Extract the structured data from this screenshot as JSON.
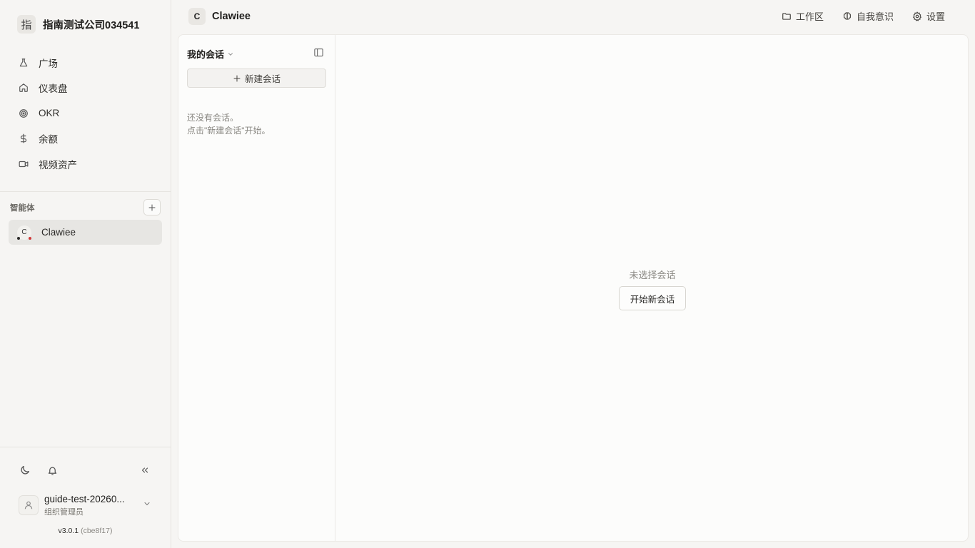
{
  "sidebar": {
    "org": {
      "avatar_char": "指",
      "name": "指南测试公司034541"
    },
    "nav": [
      {
        "icon": "flask-icon",
        "label": "广场"
      },
      {
        "icon": "home-icon",
        "label": "仪表盘"
      },
      {
        "icon": "target-icon",
        "label": "OKR"
      },
      {
        "icon": "dollar-icon",
        "label": "余额"
      },
      {
        "icon": "video-icon",
        "label": "视频资产"
      }
    ],
    "agents_label": "智能体",
    "agents": [
      {
        "avatar_char": "C",
        "name": "Clawiee",
        "status_colors": [
          "#2b2a28",
          "#d03a3a"
        ]
      }
    ],
    "user": {
      "name": "guide-test-20260...",
      "role": "组织管理员"
    },
    "version": {
      "number": "v3.0.1",
      "hash": "(cbe8f17)"
    }
  },
  "header": {
    "agent": {
      "avatar_char": "C",
      "name": "Clawiee"
    },
    "actions": [
      {
        "icon": "folder-icon",
        "label": "工作区"
      },
      {
        "icon": "brain-icon",
        "label": "自我意识"
      },
      {
        "icon": "gear-icon",
        "label": "设置"
      }
    ]
  },
  "conversations": {
    "title": "我的会话",
    "new_button": "新建会话",
    "empty_line1": "还没有会话。",
    "empty_line2": "点击\"新建会话\"开始。"
  },
  "content": {
    "no_selection": "未选择会话",
    "start_button": "开始新会话"
  }
}
